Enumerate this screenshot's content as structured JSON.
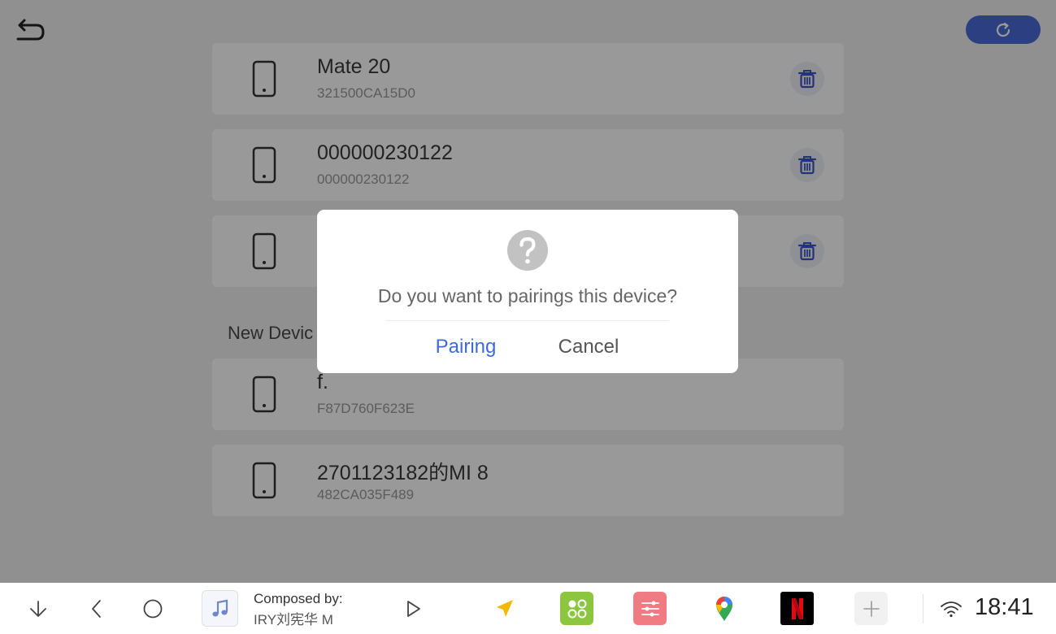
{
  "paired_devices": [
    {
      "name": "Mate 20",
      "address": "321500CA15D0"
    },
    {
      "name": "000000230122",
      "address": "000000230122"
    },
    {
      "name": "",
      "address": ""
    }
  ],
  "new_devices_label": "New Devic",
  "new_devices": [
    {
      "name": "f.",
      "address": "F87D760F623E"
    },
    {
      "name": "2701123182的MI 8",
      "address": "482CA035F489"
    }
  ],
  "dialog": {
    "message": "Do you want to pairings this device?",
    "confirm_label": "Pairing",
    "cancel_label": "Cancel"
  },
  "taskbar": {
    "media_line1": "Composed by:",
    "media_line2": "IRY刘宪华        M",
    "time": "18:41"
  },
  "colors": {
    "accent": "#4a6bd8",
    "dialog_action": "#3e6ad8"
  },
  "icons": {
    "back": "back-arrow-icon",
    "refresh": "refresh-icon",
    "device": "phone-icon",
    "delete": "trash-icon",
    "dialog": "question-icon"
  }
}
